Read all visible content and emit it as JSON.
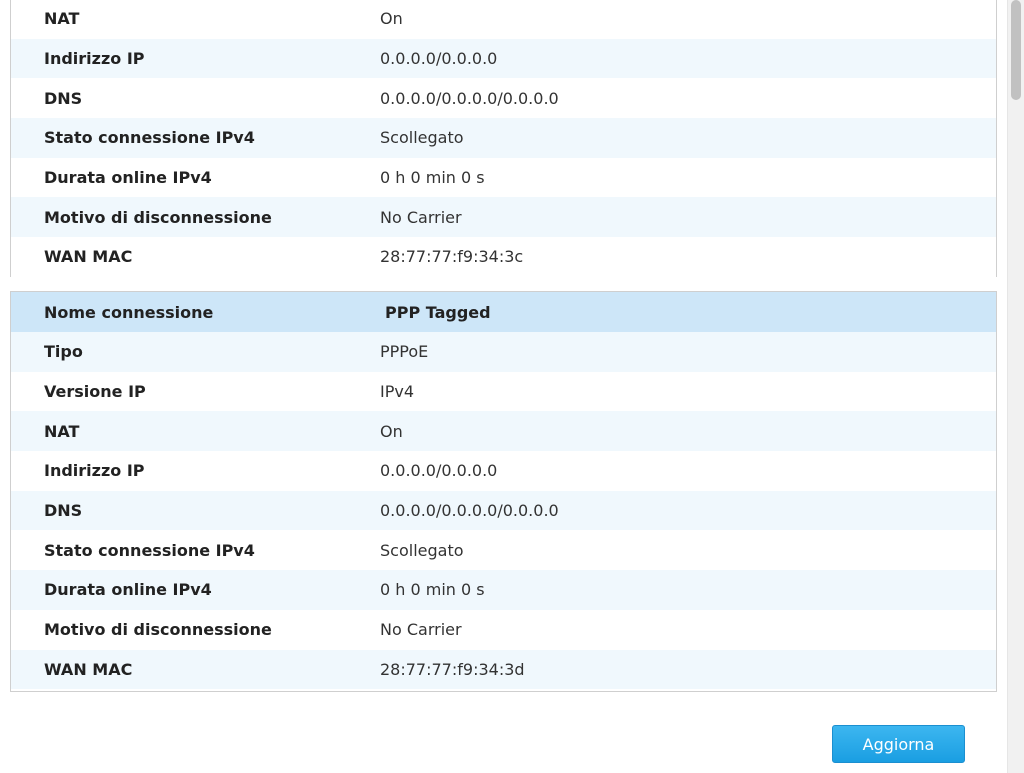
{
  "panel1": {
    "rows": [
      {
        "label": "NAT",
        "value": "On"
      },
      {
        "label": "Indirizzo IP",
        "value": "0.0.0.0/0.0.0.0"
      },
      {
        "label": "DNS",
        "value": "0.0.0.0/0.0.0.0/0.0.0.0"
      },
      {
        "label": "Stato connessione IPv4",
        "value": "Scollegato"
      },
      {
        "label": "Durata online IPv4",
        "value": "0 h 0 min 0 s"
      },
      {
        "label": "Motivo di disconnessione",
        "value": "No Carrier"
      },
      {
        "label": "WAN MAC",
        "value": "28:77:77:f9:34:3c"
      }
    ]
  },
  "panel2": {
    "header": {
      "label": "Nome connessione",
      "value": "PPP Tagged"
    },
    "rows": [
      {
        "label": "Tipo",
        "value": "PPPoE"
      },
      {
        "label": "Versione IP",
        "value": "IPv4"
      },
      {
        "label": "NAT",
        "value": "On"
      },
      {
        "label": "Indirizzo IP",
        "value": "0.0.0.0/0.0.0.0"
      },
      {
        "label": "DNS",
        "value": "0.0.0.0/0.0.0.0/0.0.0.0"
      },
      {
        "label": "Stato connessione IPv4",
        "value": "Scollegato"
      },
      {
        "label": "Durata online IPv4",
        "value": "0 h 0 min 0 s"
      },
      {
        "label": "Motivo di disconnessione",
        "value": "No Carrier"
      },
      {
        "label": "WAN MAC",
        "value": "28:77:77:f9:34:3d"
      }
    ]
  },
  "actions": {
    "refresh_label": "Aggiorna"
  },
  "colors": {
    "header_bg": "#cde6f8",
    "alt_row_bg": "#f0f8fd",
    "button_bg": "#1a9ee2"
  }
}
